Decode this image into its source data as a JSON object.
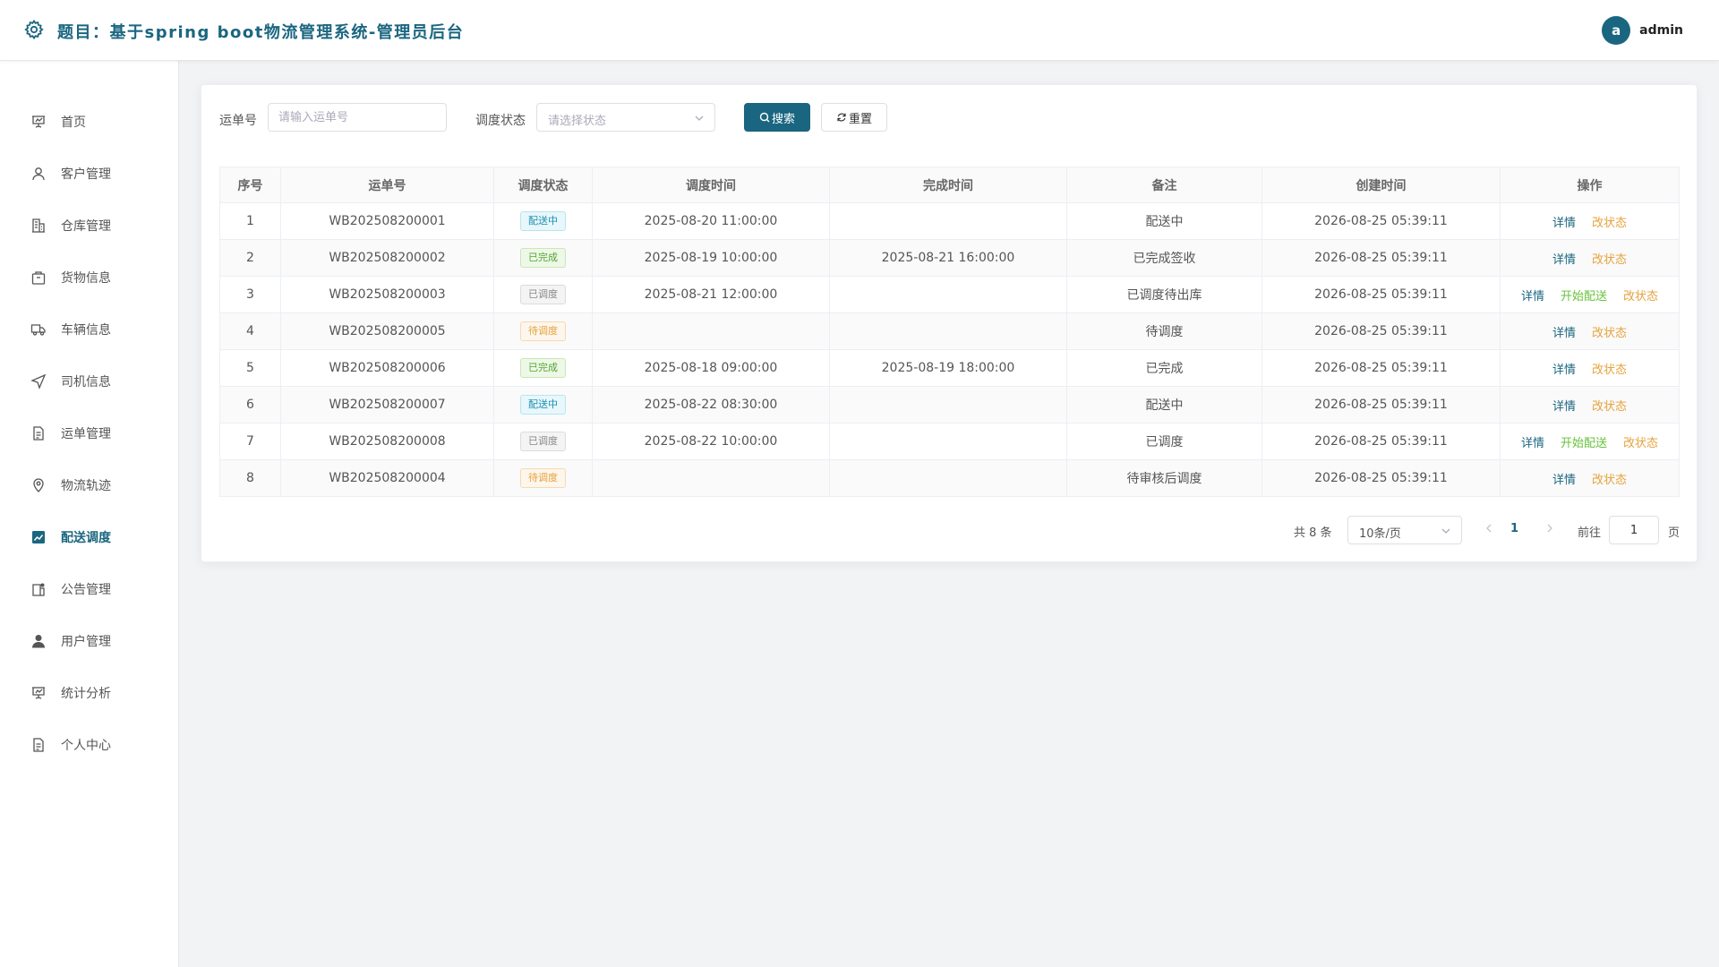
{
  "header": {
    "title": "题目：基于spring boot物流管理系统-管理员后台",
    "avatar_letter": "a",
    "username": "admin",
    "brand_color": "#1a6680"
  },
  "sidebar": {
    "items": [
      {
        "label": "首页",
        "icon": "presentation-icon",
        "active": false
      },
      {
        "label": "客户管理",
        "icon": "user-icon",
        "active": false
      },
      {
        "label": "仓库管理",
        "icon": "building-icon",
        "active": false
      },
      {
        "label": "货物信息",
        "icon": "box-icon",
        "active": false
      },
      {
        "label": "车辆信息",
        "icon": "truck-icon",
        "active": false
      },
      {
        "label": "司机信息",
        "icon": "navigation-icon",
        "active": false
      },
      {
        "label": "运单管理",
        "icon": "document-icon",
        "active": false
      },
      {
        "label": "物流轨迹",
        "icon": "location-pin-icon",
        "active": false
      },
      {
        "label": "配送调度",
        "icon": "chart-icon",
        "active": true
      },
      {
        "label": "公告管理",
        "icon": "notice-icon",
        "active": false
      },
      {
        "label": "用户管理",
        "icon": "person-icon",
        "active": false
      },
      {
        "label": "统计分析",
        "icon": "presentation-icon",
        "active": false
      },
      {
        "label": "个人中心",
        "icon": "document-icon",
        "active": false
      }
    ]
  },
  "filters": {
    "waybill_label": "运单号",
    "waybill_placeholder": "请输入运单号",
    "status_label": "调度状态",
    "status_placeholder": "请选择状态",
    "search_button": "搜索",
    "reset_button": "重置"
  },
  "table": {
    "columns": [
      "序号",
      "运单号",
      "调度状态",
      "调度时间",
      "完成时间",
      "备注",
      "创建时间",
      "操作"
    ],
    "rows": [
      {
        "index": "1",
        "waybill": "WB202508200001",
        "status": "配送中",
        "status_color": "blue",
        "dispatch_time": "2025-08-20 11:00:00",
        "complete_time": "",
        "remark": "配送中",
        "created": "2026-08-25 05:39:11",
        "actions": [
          "详情",
          "改状态"
        ]
      },
      {
        "index": "2",
        "waybill": "WB202508200002",
        "status": "已完成",
        "status_color": "green",
        "dispatch_time": "2025-08-19 10:00:00",
        "complete_time": "2025-08-21 16:00:00",
        "remark": "已完成签收",
        "created": "2026-08-25 05:39:11",
        "actions": [
          "详情",
          "改状态"
        ]
      },
      {
        "index": "3",
        "waybill": "WB202508200003",
        "status": "已调度",
        "status_color": "gray",
        "dispatch_time": "2025-08-21 12:00:00",
        "complete_time": "",
        "remark": "已调度待出库",
        "created": "2026-08-25 05:39:11",
        "actions": [
          "详情",
          "开始配送",
          "改状态"
        ]
      },
      {
        "index": "4",
        "waybill": "WB202508200005",
        "status": "待调度",
        "status_color": "orange",
        "dispatch_time": "",
        "complete_time": "",
        "remark": "待调度",
        "created": "2026-08-25 05:39:11",
        "actions": [
          "详情",
          "改状态"
        ]
      },
      {
        "index": "5",
        "waybill": "WB202508200006",
        "status": "已完成",
        "status_color": "green",
        "dispatch_time": "2025-08-18 09:00:00",
        "complete_time": "2025-08-19 18:00:00",
        "remark": "已完成",
        "created": "2026-08-25 05:39:11",
        "actions": [
          "详情",
          "改状态"
        ]
      },
      {
        "index": "6",
        "waybill": "WB202508200007",
        "status": "配送中",
        "status_color": "blue",
        "dispatch_time": "2025-08-22 08:30:00",
        "complete_time": "",
        "remark": "配送中",
        "created": "2026-08-25 05:39:11",
        "actions": [
          "详情",
          "改状态"
        ]
      },
      {
        "index": "7",
        "waybill": "WB202508200008",
        "status": "已调度",
        "status_color": "gray",
        "dispatch_time": "2025-08-22 10:00:00",
        "complete_time": "",
        "remark": "已调度",
        "created": "2026-08-25 05:39:11",
        "actions": [
          "详情",
          "开始配送",
          "改状态"
        ]
      },
      {
        "index": "8",
        "waybill": "WB202508200004",
        "status": "待调度",
        "status_color": "orange",
        "dispatch_time": "",
        "complete_time": "",
        "remark": "待审核后调度",
        "created": "2026-08-25 05:39:11",
        "actions": [
          "详情",
          "改状态"
        ]
      }
    ]
  },
  "pagination": {
    "total_text": "共 8 条",
    "page_size": "10条/页",
    "current_page": "1",
    "goto_label": "前往",
    "goto_value": "1",
    "page_suffix": "页"
  }
}
